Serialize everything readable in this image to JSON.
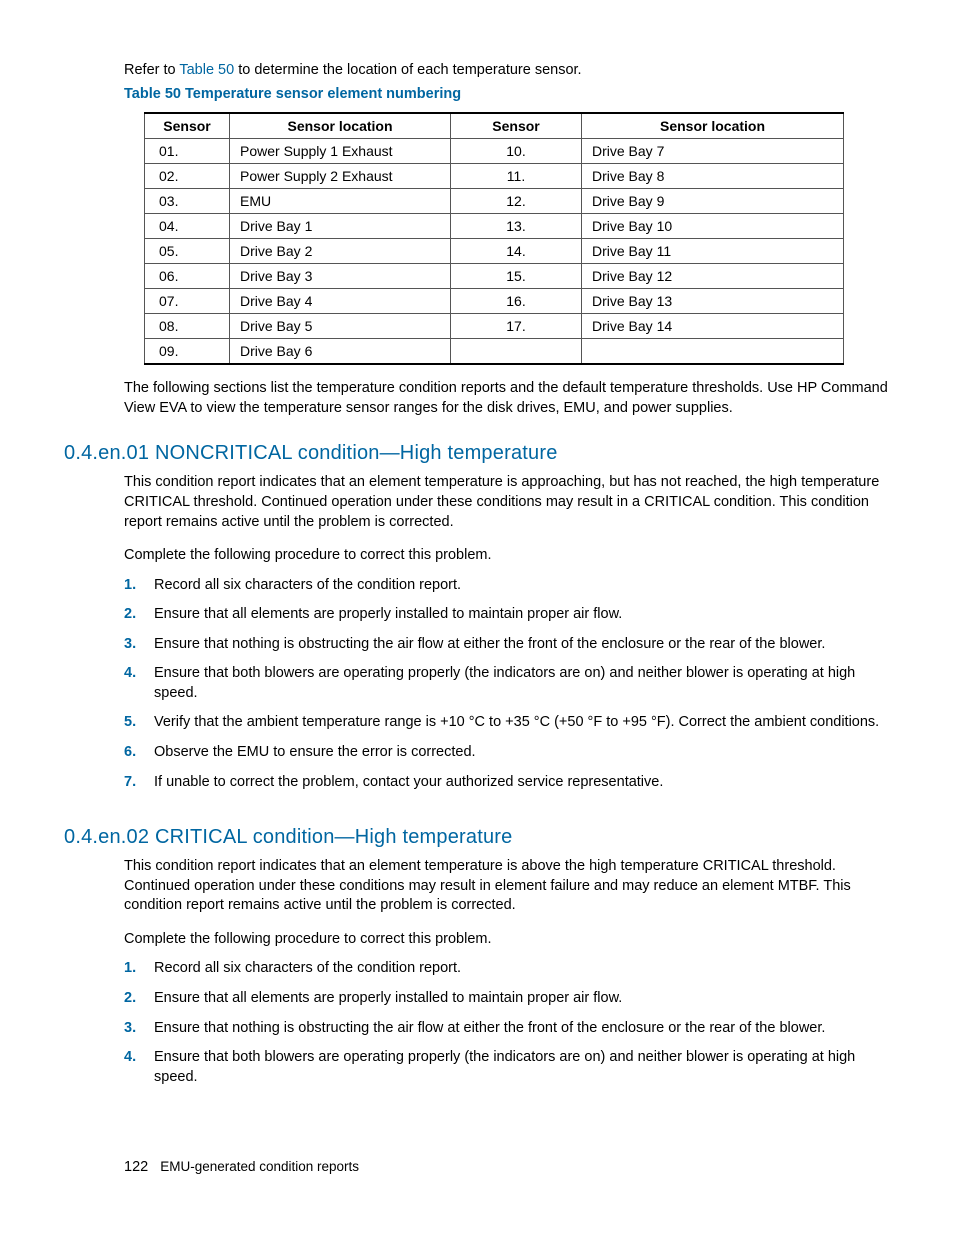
{
  "intro": {
    "prefix": "Refer to ",
    "link": "Table 50",
    "suffix": " to determine the location of each temperature sensor."
  },
  "table": {
    "title": "Table 50 Temperature sensor element numbering",
    "headers": [
      "Sensor",
      "Sensor location",
      "Sensor",
      "Sensor location"
    ],
    "rows": [
      [
        "01.",
        "Power Supply 1 Exhaust",
        "10.",
        "Drive Bay 7"
      ],
      [
        "02.",
        "Power Supply 2 Exhaust",
        "11.",
        "Drive Bay 8"
      ],
      [
        "03.",
        "EMU",
        "12.",
        "Drive Bay 9"
      ],
      [
        "04.",
        "Drive Bay 1",
        "13.",
        "Drive Bay 10"
      ],
      [
        "05.",
        "Drive Bay 2",
        "14.",
        "Drive Bay 11"
      ],
      [
        "06.",
        "Drive Bay 3",
        "15.",
        "Drive Bay 12"
      ],
      [
        "07.",
        "Drive Bay 4",
        "16.",
        "Drive Bay 13"
      ],
      [
        "08.",
        "Drive Bay 5",
        "17.",
        "Drive Bay 14"
      ],
      [
        "09.",
        "Drive Bay 6",
        "",
        ""
      ]
    ]
  },
  "post_table": "The following sections list the temperature condition reports and the default temperature thresholds. Use HP Command View EVA to view the temperature sensor ranges for the disk drives, EMU, and power supplies.",
  "section1": {
    "heading": "0.4.en.01 NONCRITICAL condition—High temperature",
    "p1": "This condition report indicates that an element temperature is approaching, but has not reached, the high temperature CRITICAL threshold. Continued operation under these conditions may result in a CRITICAL condition. This condition report remains active until the problem is corrected.",
    "p2": "Complete the following procedure to correct this problem.",
    "steps": [
      "Record all six characters of the condition report.",
      "Ensure that all elements are properly installed to maintain proper air flow.",
      "Ensure that nothing is obstructing the air flow at either the front of the enclosure or the rear of the blower.",
      "Ensure that both blowers are operating properly (the indicators are on) and neither blower is operating at high speed.",
      "Verify that the ambient temperature range is +10 °C to +35 °C (+50 °F to +95 °F). Correct the ambient conditions.",
      "Observe the EMU to ensure the error is corrected.",
      "If unable to correct the problem, contact your authorized service representative."
    ]
  },
  "section2": {
    "heading": "0.4.en.02 CRITICAL condition—High temperature",
    "p1": "This condition report indicates that an element temperature is above the high temperature CRITICAL threshold. Continued operation under these conditions may result in element failure and may reduce an element MTBF. This condition report remains active until the problem is corrected.",
    "p2": "Complete the following procedure to correct this problem.",
    "steps": [
      "Record all six characters of the condition report.",
      "Ensure that all elements are properly installed to maintain proper air flow.",
      "Ensure that nothing is obstructing the air flow at either the front of the enclosure or the rear of the blower.",
      "Ensure that both blowers are operating properly (the indicators are on) and neither blower is operating at high speed."
    ]
  },
  "footer": {
    "page": "122",
    "title": "EMU-generated condition reports"
  }
}
